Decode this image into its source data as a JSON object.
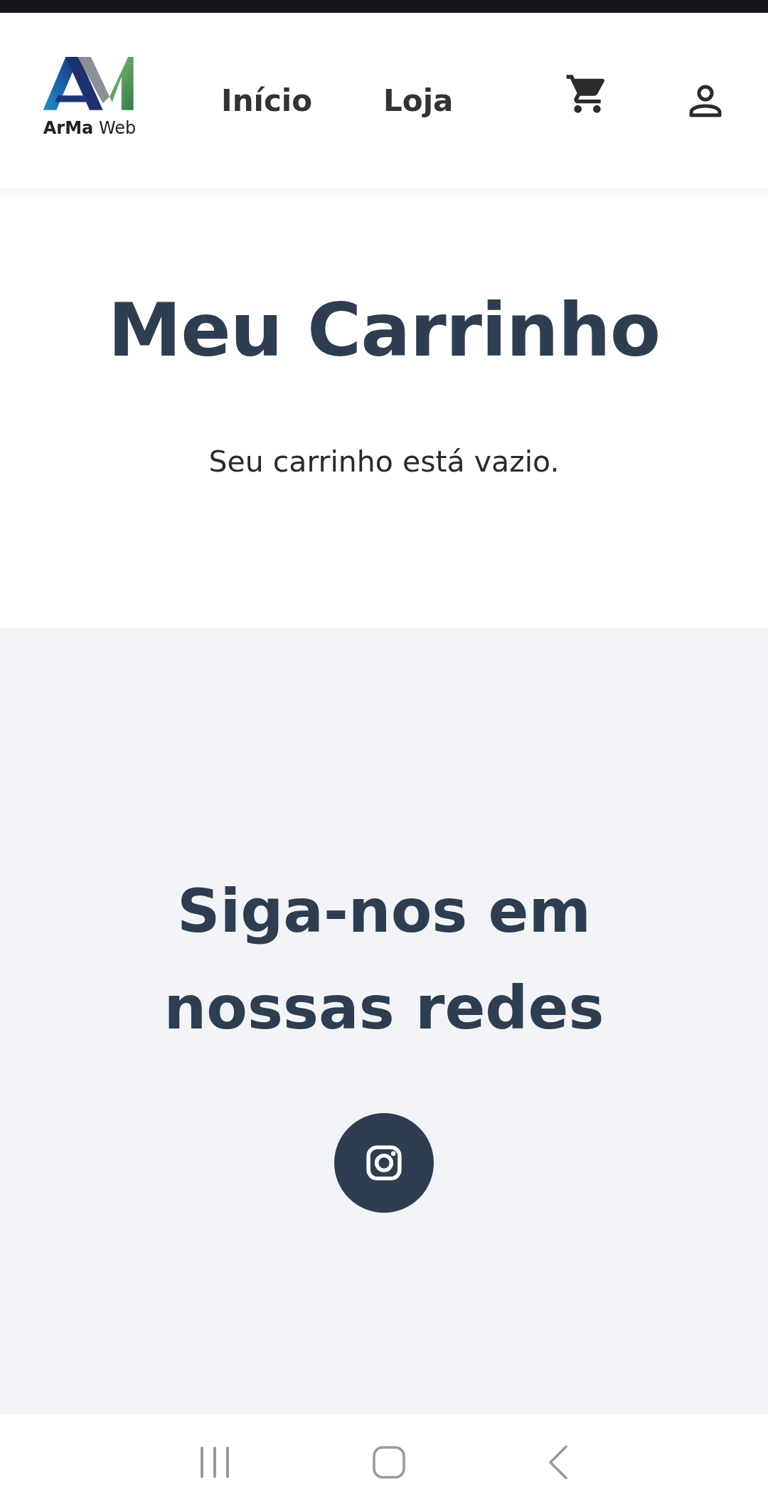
{
  "header": {
    "logo": {
      "text": "**ArMa** Web"
    },
    "nav": [
      {
        "label": "Início"
      },
      {
        "label": "Loja"
      }
    ]
  },
  "cart": {
    "title": "Meu Carrinho",
    "empty_message": "Seu carrinho está vazio."
  },
  "social": {
    "heading": "Siga-nos em nossas redes",
    "links": [
      {
        "kind": "instagram"
      }
    ]
  }
}
